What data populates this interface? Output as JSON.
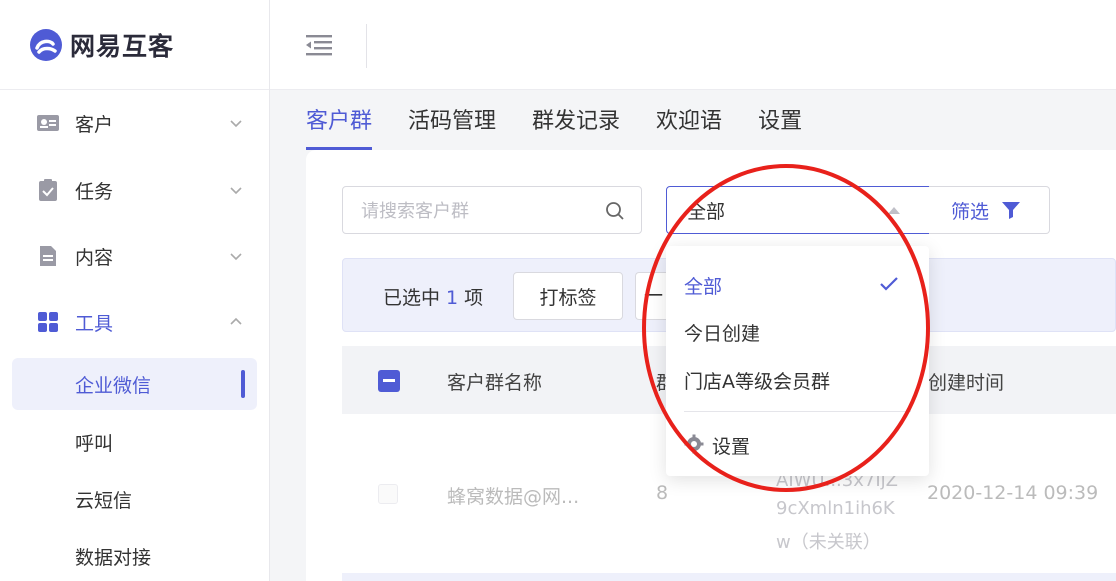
{
  "brand": {
    "name": "网易互客",
    "accent": "#4f5bd5"
  },
  "sidebar": {
    "groups": [
      {
        "label": "客户",
        "icon": "id-card-icon"
      },
      {
        "label": "任务",
        "icon": "clipboard-check-icon"
      },
      {
        "label": "内容",
        "icon": "document-icon"
      },
      {
        "label": "工具",
        "icon": "grid-icon"
      }
    ],
    "tool_items": [
      {
        "label": "企业微信"
      },
      {
        "label": "呼叫"
      },
      {
        "label": "云短信"
      },
      {
        "label": "数据对接"
      }
    ]
  },
  "tabs": [
    {
      "label": "客户群"
    },
    {
      "label": "活码管理"
    },
    {
      "label": "群发记录"
    },
    {
      "label": "欢迎语"
    },
    {
      "label": "设置"
    }
  ],
  "toolbar": {
    "search_placeholder": "请搜索客户群",
    "select_value": "全部",
    "filter_label": "筛选"
  },
  "selection": {
    "prefix": "已选中",
    "count": "1",
    "suffix": "项",
    "tag_button": "打标签",
    "next_button": "一"
  },
  "table": {
    "headers": [
      "客户群名称",
      "群",
      "创建时间"
    ],
    "rows": [
      {
        "name": "蜂窝数据@网...",
        "count": "8",
        "id_lines": [
          "AIWU...3x7IjZ",
          "9cXmln1ih6K",
          "w（未关联）"
        ],
        "created": "2020-12-14 09:39"
      }
    ]
  },
  "dropdown": {
    "options": [
      {
        "label": "全部",
        "selected": true
      },
      {
        "label": "今日创建",
        "selected": false
      },
      {
        "label": "门店A等级会员群",
        "selected": false
      }
    ],
    "settings_label": "设置"
  },
  "annotation_color": "#e8211b"
}
